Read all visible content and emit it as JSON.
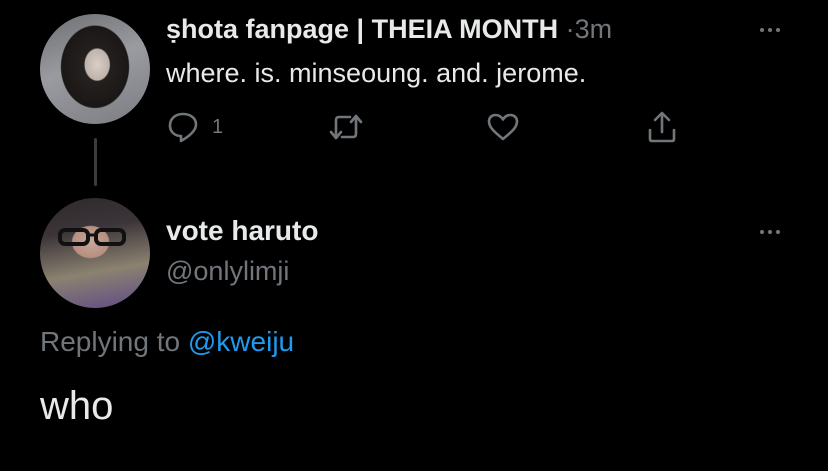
{
  "tweet1": {
    "display_name": "ṣhota fanpage | THEIA MONTH",
    "separator": "·",
    "time": "3m",
    "text": "where. is. minseoung. and. jerome.",
    "reply_count": "1",
    "icons": {
      "reply": "reply-icon",
      "retweet": "retweet-icon",
      "like": "heart-icon",
      "share": "share-icon",
      "more": "more-icon"
    }
  },
  "tweet2": {
    "display_name": "vote haruto",
    "handle": "@onlylimji",
    "replying_prefix": "Replying to",
    "replying_handle": "@kweiju",
    "text": "who",
    "icons": {
      "more": "more-icon"
    }
  },
  "colors": {
    "background": "#000000",
    "primary_text": "#e7e9ea",
    "secondary_text": "#71767b",
    "link": "#1d9bf0",
    "thread_line": "#3a3d40"
  }
}
